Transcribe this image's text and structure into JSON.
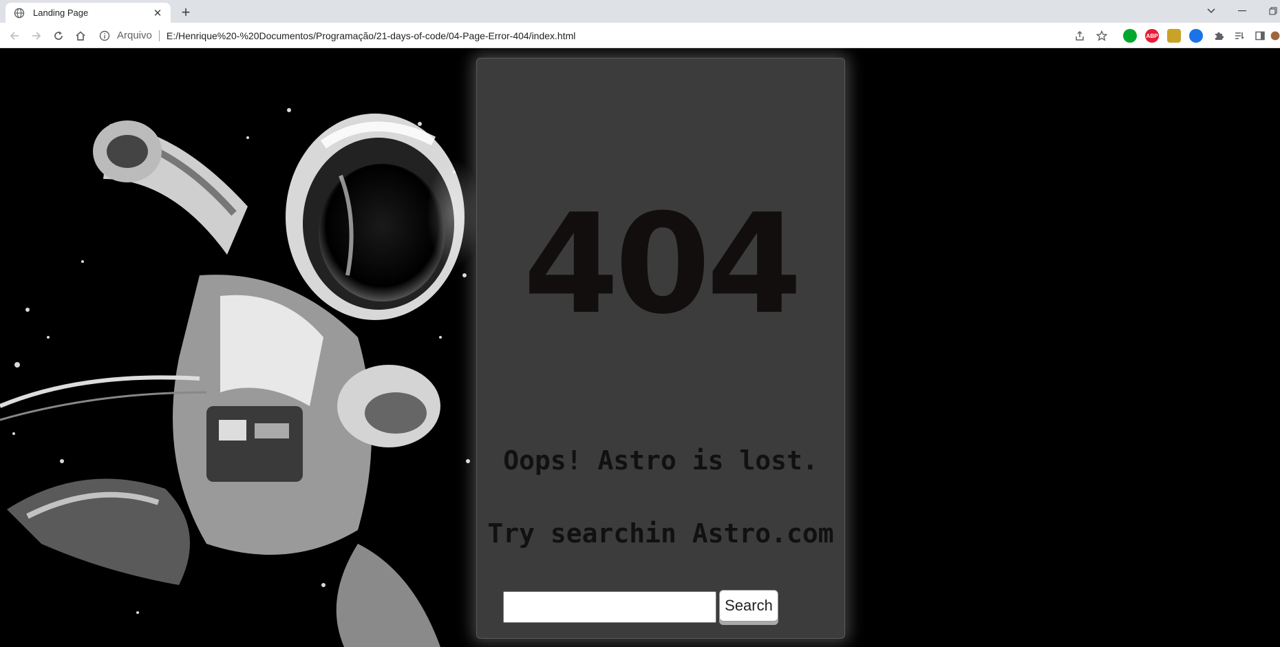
{
  "browser": {
    "tab": {
      "title": "Landing Page"
    },
    "address": {
      "scheme": "Arquivo",
      "url": "E:/Henrique%20-%20Documentos/Programação/21-days-of-code/04-Page-Error-404/index.html"
    },
    "extensions": [
      {
        "name": "evernote-icon",
        "color": "#00a82d"
      },
      {
        "name": "adblock-plus-icon",
        "color": "#e81c36",
        "label": "ABP"
      },
      {
        "name": "burger-extension-icon",
        "color": "#c9a227"
      },
      {
        "name": "shield-extension-icon",
        "color": "#1a73e8"
      }
    ]
  },
  "page": {
    "code": "404",
    "message": "Oops! Astro is lost.",
    "hint": "Try searchin Astro.com",
    "search": {
      "value": "",
      "button_label": "Search"
    },
    "colors": {
      "background": "#000000",
      "card": "#3c3c3c",
      "text": "#130e0e"
    }
  }
}
